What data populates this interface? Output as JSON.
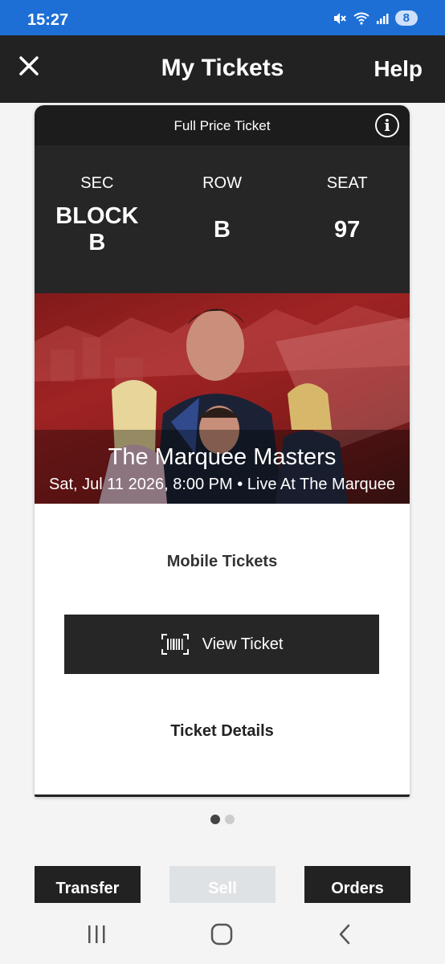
{
  "status_bar": {
    "time": "15:27",
    "battery": "8",
    "icons": [
      "mute-icon",
      "wifi-icon",
      "signal-icon"
    ]
  },
  "header": {
    "title": "My Tickets",
    "help": "Help"
  },
  "ticket": {
    "type": "Full Price Ticket",
    "sec_label": "SEC",
    "sec_value_line1": "BLOCK",
    "sec_value_line2": "B",
    "row_label": "ROW",
    "row_value": "B",
    "seat_label": "SEAT",
    "seat_value": "97",
    "event_name": "The Marquee Masters",
    "event_meta": "Sat, Jul 11 2026, 8:00 PM • Live At The Marquee",
    "mobile_tickets": "Mobile Tickets",
    "view_ticket": "View Ticket",
    "ticket_details": "Ticket Details"
  },
  "pager": {
    "pages": 2,
    "active": 0
  },
  "actions": {
    "transfer": "Transfer",
    "sell": "Sell",
    "orders": "Orders"
  },
  "colors": {
    "status_bar": "#1d6fd6",
    "header": "#222222",
    "card_dark": "#262626",
    "banner_red": "#a82626"
  }
}
